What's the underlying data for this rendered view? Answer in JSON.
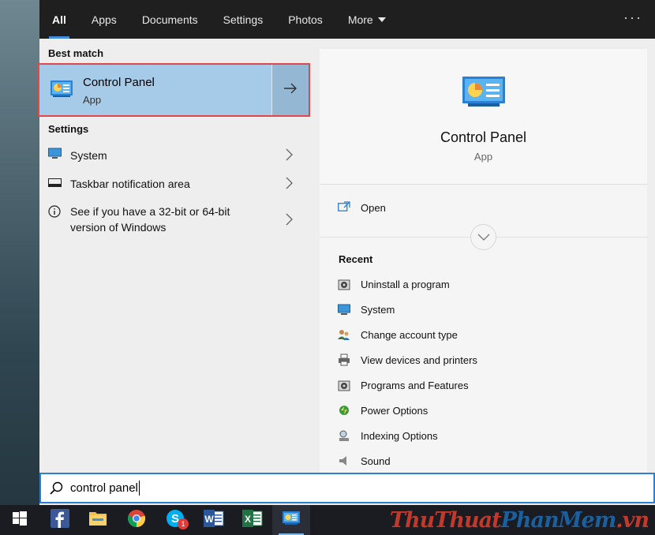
{
  "tabs": [
    {
      "label": "All",
      "active": true
    },
    {
      "label": "Apps"
    },
    {
      "label": "Documents"
    },
    {
      "label": "Settings"
    },
    {
      "label": "Photos"
    },
    {
      "label": "More"
    }
  ],
  "more_menu_icon": "ellipsis-icon",
  "results": {
    "best_match_heading": "Best match",
    "best_match": {
      "title": "Control Panel",
      "subtitle": "App",
      "icon": "control-panel-icon"
    },
    "settings_heading": "Settings",
    "settings": [
      {
        "label": "System",
        "icon": "monitor-icon"
      },
      {
        "label": "Taskbar notification area",
        "icon": "taskbar-icon"
      },
      {
        "label": "See if you have a 32-bit or 64-bit version of Windows",
        "icon": "info-icon"
      }
    ]
  },
  "preview": {
    "title": "Control Panel",
    "subtitle": "App",
    "open_label": "Open",
    "recent_heading": "Recent",
    "recent": [
      {
        "label": "Uninstall a program",
        "icon": "programs-icon"
      },
      {
        "label": "System",
        "icon": "monitor-icon"
      },
      {
        "label": "Change account type",
        "icon": "users-icon"
      },
      {
        "label": "View devices and printers",
        "icon": "printer-icon"
      },
      {
        "label": "Programs and Features",
        "icon": "programs-icon"
      },
      {
        "label": "Power Options",
        "icon": "power-icon"
      },
      {
        "label": "Indexing Options",
        "icon": "indexing-icon"
      },
      {
        "label": "Sound",
        "icon": "speaker-icon"
      }
    ]
  },
  "search": {
    "query": "control panel"
  },
  "taskbar": {
    "items": [
      "start-icon",
      "facebook-icon",
      "file-explorer-icon",
      "chrome-icon",
      "skype-icon",
      "word-icon",
      "excel-icon",
      "control-panel-icon"
    ],
    "skype_badge": "1"
  },
  "watermark": {
    "part1": "ThuThuat",
    "part2": "PhanMem",
    "part3": ".vn"
  },
  "colors": {
    "accent": "#2b7fd4",
    "selection": "#a6cbe9",
    "highlight_border": "#e2474b"
  }
}
